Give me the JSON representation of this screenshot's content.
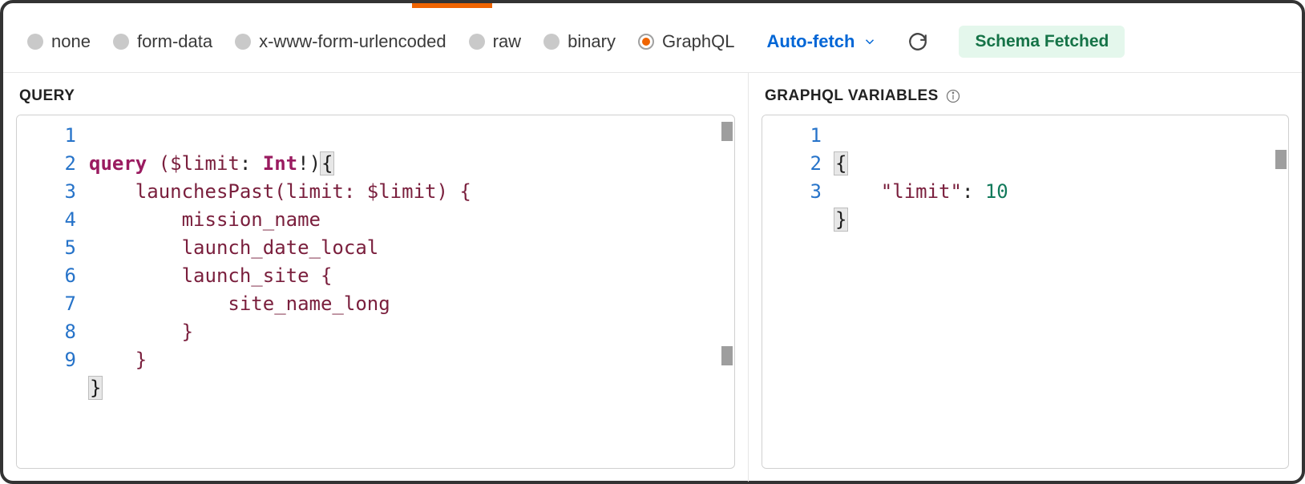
{
  "toolbar": {
    "body_types": [
      {
        "id": "none",
        "label": "none",
        "selected": false
      },
      {
        "id": "form-data",
        "label": "form-data",
        "selected": false
      },
      {
        "id": "x-www-form-urlencoded",
        "label": "x-www-form-urlencoded",
        "selected": false
      },
      {
        "id": "raw",
        "label": "raw",
        "selected": false
      },
      {
        "id": "binary",
        "label": "binary",
        "selected": false
      },
      {
        "id": "graphql",
        "label": "GraphQL",
        "selected": true
      }
    ],
    "autofetch_label": "Auto-fetch",
    "schema_status": "Schema Fetched"
  },
  "query_panel": {
    "title": "QUERY",
    "line_count": 9,
    "code": "query ($limit: Int!){\n    launchesPast(limit: $limit) {\n        mission_name\n        launch_date_local\n        launch_site {\n            site_name_long\n        }\n    }\n}",
    "tokens": {
      "l1_kw": "query",
      "l1_var": " ($limit",
      "l1_colon": ": ",
      "l1_type": "Int",
      "l1_bang": "!",
      "l1_paren": ")",
      "l1_brace": "{",
      "l2": "    launchesPast(limit: $limit) {",
      "l3": "        mission_name",
      "l4": "        launch_date_local",
      "l5": "        launch_site {",
      "l6": "            site_name_long",
      "l7": "        }",
      "l8": "    }",
      "l9": "}"
    }
  },
  "vars_panel": {
    "title": "GRAPHQL VARIABLES",
    "line_count": 3,
    "code": "{\n    \"limit\": 10\n}",
    "tokens": {
      "l1": "{",
      "l2_key": "\"limit\"",
      "l2_colon": ": ",
      "l2_val": "10",
      "l3": "}"
    }
  }
}
